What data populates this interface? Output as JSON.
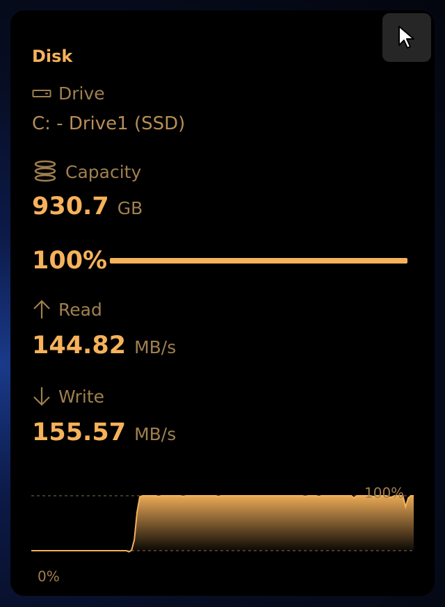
{
  "widget": {
    "title": "Disk",
    "drive": {
      "label": "Drive",
      "value": "C: - Drive1 (SSD)"
    },
    "capacity": {
      "label": "Capacity",
      "value": "930.7",
      "unit": "GB"
    },
    "usage": {
      "percent_text": "100%",
      "percent": 100
    },
    "read": {
      "label": "Read",
      "value": "144.82",
      "unit": "MB/s"
    },
    "write": {
      "label": "Write",
      "value": "155.57",
      "unit": "MB/s"
    },
    "graph": {
      "max_label": "100%",
      "min_label": "0%",
      "values": [
        0,
        0,
        0,
        0,
        0,
        0,
        0,
        0,
        0,
        0,
        0,
        0,
        0,
        0,
        0,
        0,
        0,
        0,
        0,
        0,
        0,
        0,
        0,
        0,
        0,
        0,
        0,
        0,
        0,
        0,
        0,
        0,
        0,
        0,
        0,
        0,
        -2,
        1,
        20,
        70,
        98,
        100,
        100,
        100,
        100,
        100,
        100,
        99,
        100,
        100,
        100,
        100,
        100,
        100,
        100,
        100,
        99,
        100,
        100,
        100,
        100,
        100,
        100,
        100,
        100,
        100,
        100,
        100,
        100,
        99,
        100,
        100,
        100,
        100,
        100,
        100,
        100,
        100,
        100,
        100,
        100,
        100,
        100,
        100,
        100,
        100,
        100,
        100,
        100,
        100,
        100,
        100,
        100,
        100,
        100,
        100,
        100,
        100,
        100,
        100,
        100,
        99,
        100,
        100,
        100,
        100,
        99,
        100,
        100,
        100,
        100,
        100,
        100,
        100,
        100,
        100,
        100,
        100,
        100,
        96,
        100,
        100,
        100,
        100,
        100,
        100,
        98,
        100,
        100,
        100,
        100,
        100,
        97,
        98,
        100,
        100,
        100,
        100,
        80,
        96,
        100,
        100
      ]
    }
  },
  "colors": {
    "accent": "#f6b25b",
    "muted": "#a0804f",
    "background": "#000000"
  },
  "icons": {
    "drive": "hard-drive-icon",
    "capacity": "database-stack-icon",
    "read": "arrow-up-icon",
    "write": "arrow-down-icon",
    "pointer": "cursor-arrow-icon"
  }
}
